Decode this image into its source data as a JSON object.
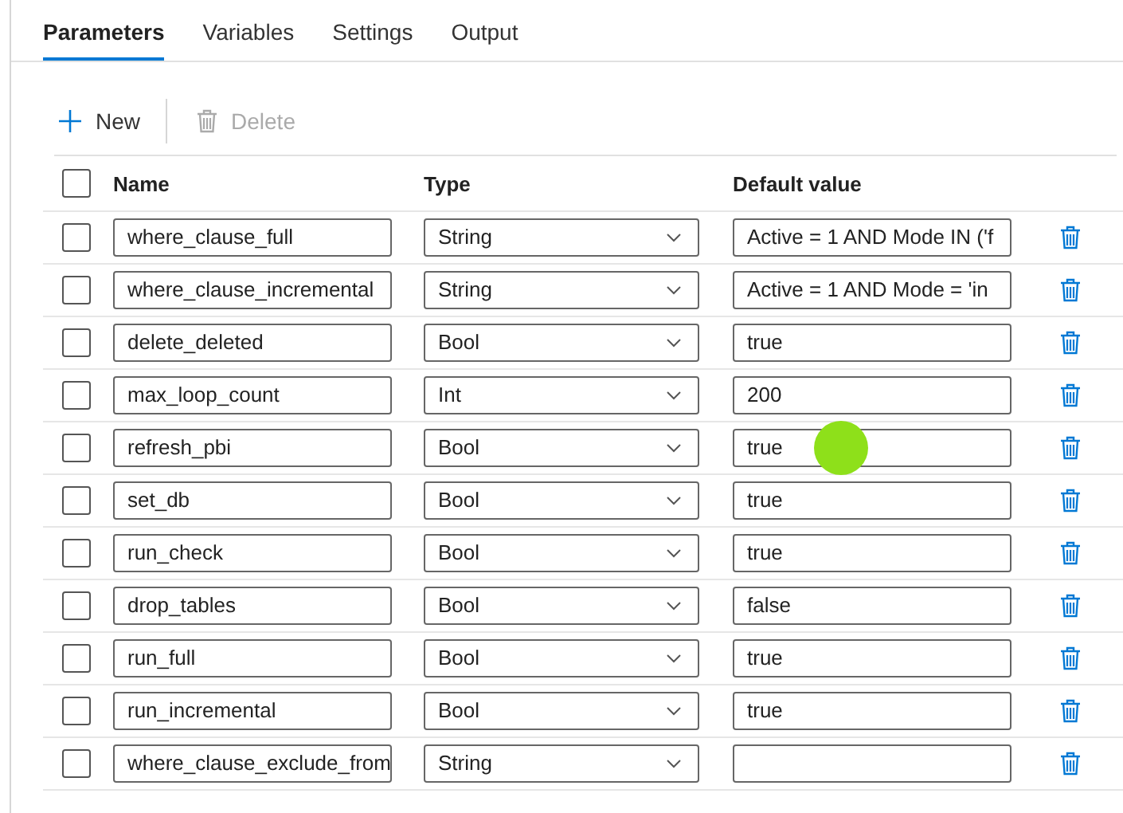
{
  "tabs": [
    {
      "label": "Parameters",
      "selected": true
    },
    {
      "label": "Variables",
      "selected": false
    },
    {
      "label": "Settings",
      "selected": false
    },
    {
      "label": "Output",
      "selected": false
    }
  ],
  "toolbar": [
    {
      "label": "New",
      "kind": "new",
      "disabled": false
    },
    {
      "label": "Delete",
      "kind": "delete",
      "disabled": true
    }
  ],
  "table": {
    "select_all_checked": false,
    "columns": [
      "Name",
      "Type",
      "Default value"
    ],
    "rows": [
      {
        "checked": false,
        "name": "where_clause_full",
        "type": "String",
        "default_value": "Active = 1 AND Mode IN ('f"
      },
      {
        "checked": false,
        "name": "where_clause_incremental",
        "type": "String",
        "default_value": "Active = 1 AND Mode = 'in"
      },
      {
        "checked": false,
        "name": "delete_deleted",
        "type": "Bool",
        "default_value": "true"
      },
      {
        "checked": false,
        "name": "max_loop_count",
        "type": "Int",
        "default_value": "200"
      },
      {
        "checked": false,
        "name": "refresh_pbi",
        "type": "Bool",
        "default_value": "true"
      },
      {
        "checked": false,
        "name": "set_db",
        "type": "Bool",
        "default_value": "true"
      },
      {
        "checked": false,
        "name": "run_check",
        "type": "Bool",
        "default_value": "true"
      },
      {
        "checked": false,
        "name": "drop_tables",
        "type": "Bool",
        "default_value": "false"
      },
      {
        "checked": false,
        "name": "run_full",
        "type": "Bool",
        "default_value": "true"
      },
      {
        "checked": false,
        "name": "run_incremental",
        "type": "Bool",
        "default_value": "true"
      },
      {
        "checked": false,
        "name": "where_clause_exclude_from",
        "type": "String",
        "default_value": ""
      }
    ]
  }
}
